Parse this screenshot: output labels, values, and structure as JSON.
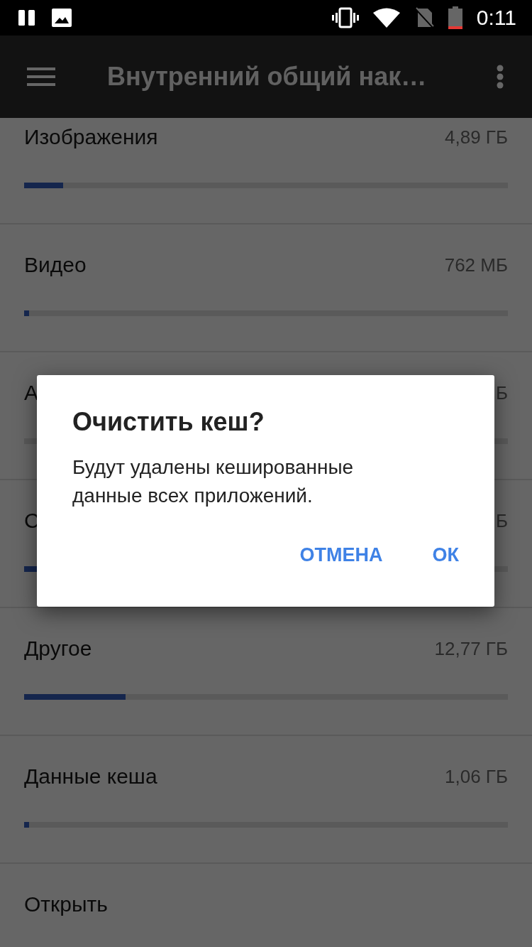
{
  "status_bar": {
    "time": "0:11"
  },
  "toolbar": {
    "title": "Внутренний общий нак…"
  },
  "storage_items": [
    {
      "kind": "category",
      "label": "Изображения",
      "size": "4,89 ГБ",
      "level": 0.08
    },
    {
      "kind": "category",
      "label": "Видео",
      "size": "762 МБ",
      "level": 0.01
    },
    {
      "kind": "category",
      "label": "А",
      "size": "Б"
    },
    {
      "kind": "category",
      "label": "С",
      "size": "Б",
      "level": 0.03
    },
    {
      "kind": "category",
      "label": "Другое",
      "size": "12,77 ГБ",
      "level": 0.21
    },
    {
      "kind": "category",
      "label": "Данные кеша",
      "size": "1,06 ГБ",
      "level": 0.01
    },
    {
      "kind": "action",
      "label": "Открыть"
    }
  ],
  "dialog": {
    "title": "Очистить кеш?",
    "message": "Будут удалены кешированные данные всех приложений.",
    "buttons": [
      {
        "label": "ОТМЕНА"
      },
      {
        "label": "ОК"
      }
    ]
  }
}
